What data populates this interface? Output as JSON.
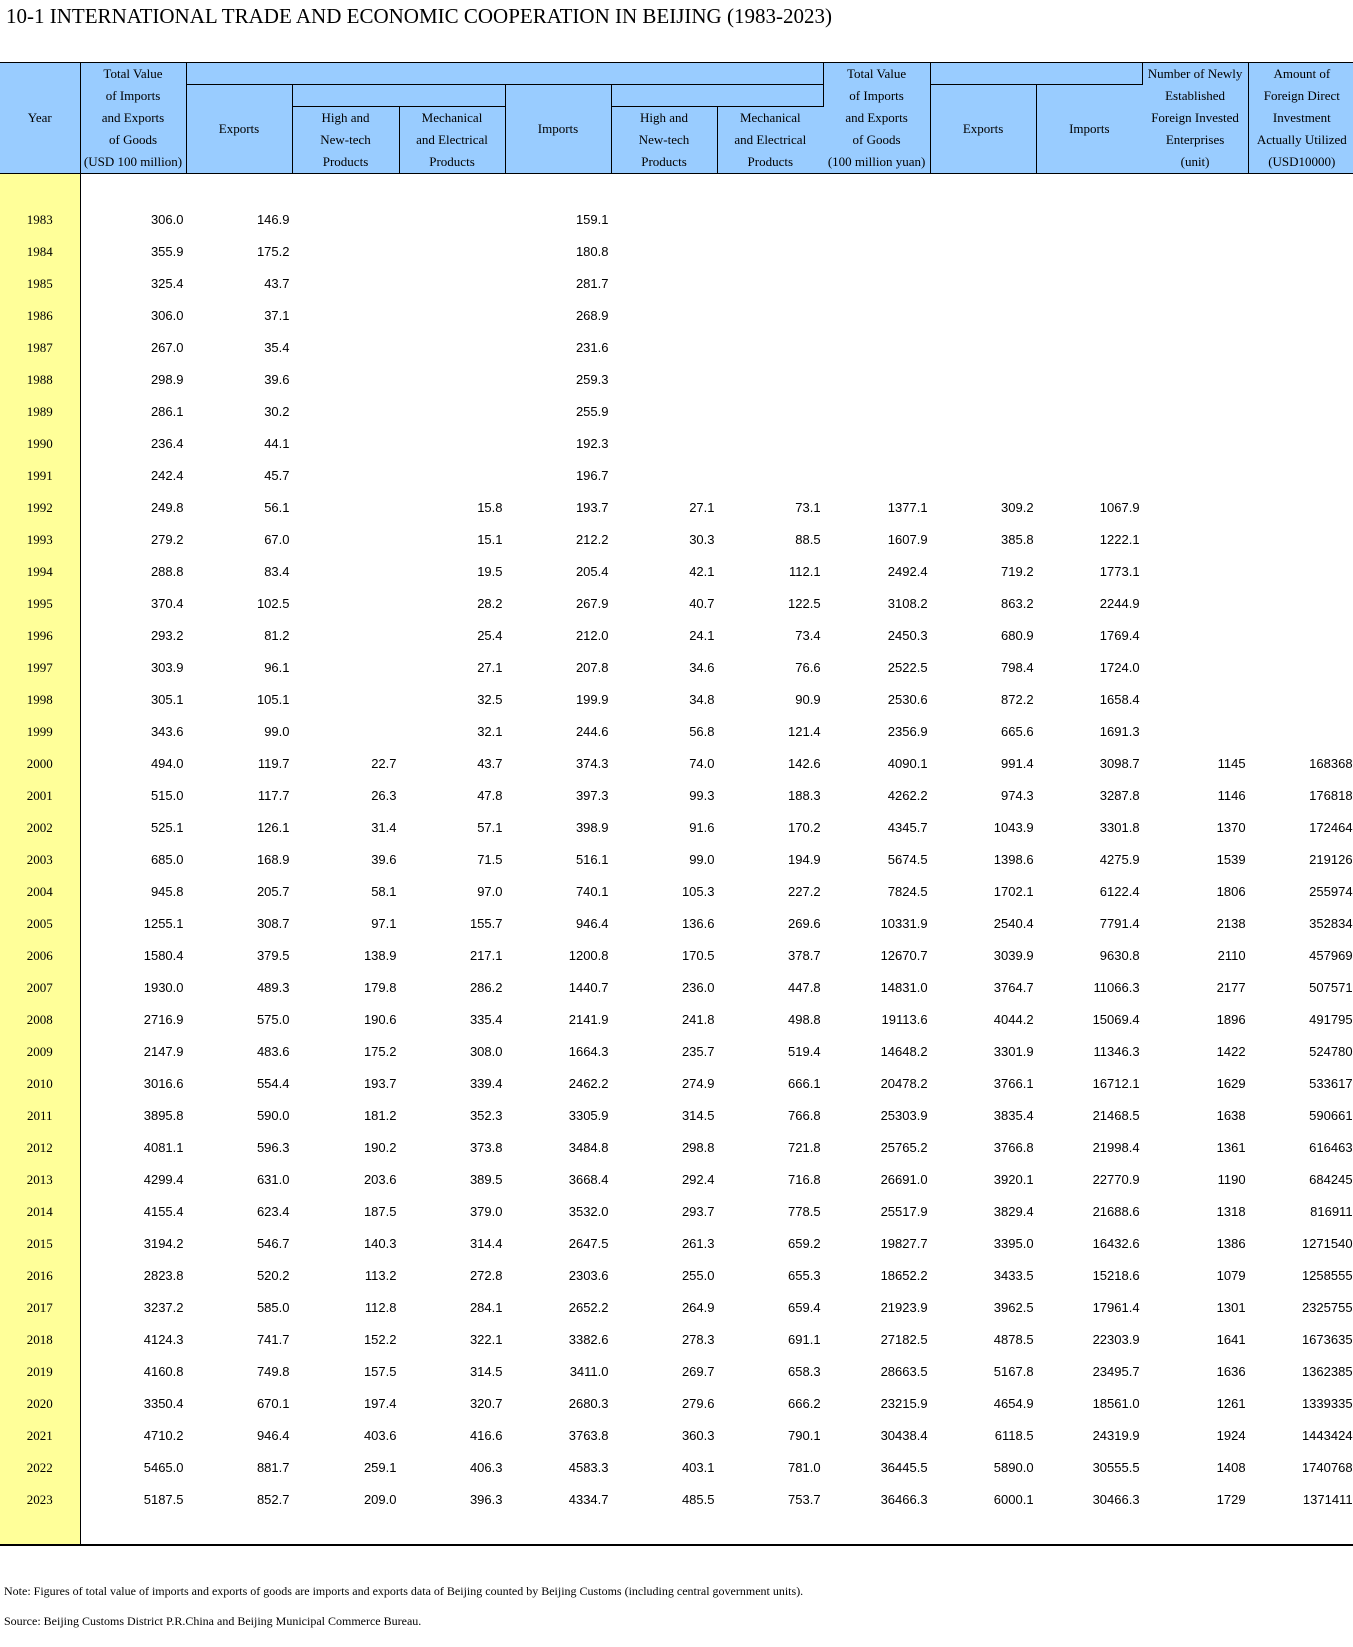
{
  "title": "10-1  INTERNATIONAL TRADE AND ECONOMIC COOPERATION IN BEIJING (1983-2023)",
  "headers": {
    "year": "Year",
    "total_usd": [
      "Total Value",
      "of Imports",
      "and Exports",
      "of Goods",
      "(USD 100 million)"
    ],
    "exports": "Exports",
    "high_tech": [
      "High and",
      "New-tech",
      "Products"
    ],
    "mech_elec": [
      "Mechanical",
      "and Electrical",
      "Products"
    ],
    "imports": "Imports",
    "total_yuan": [
      "Total Value",
      "of Imports",
      "and Exports",
      "of Goods",
      "(100 million yuan)"
    ],
    "exports_yuan": "Exports",
    "imports_yuan": "Imports",
    "enterprises": [
      "Number of Newly",
      "Established",
      "Foreign Invested",
      "Enterprises",
      "(unit)"
    ],
    "fdi": [
      "Amount of",
      "Foreign Direct",
      "Investment",
      "Actually Utilized",
      "(USD10000)"
    ]
  },
  "rows": [
    [
      "1983",
      "306.0",
      "146.9",
      "",
      "",
      "159.1",
      "",
      "",
      "",
      "",
      "",
      "",
      ""
    ],
    [
      "1984",
      "355.9",
      "175.2",
      "",
      "",
      "180.8",
      "",
      "",
      "",
      "",
      "",
      "",
      ""
    ],
    [
      "1985",
      "325.4",
      "43.7",
      "",
      "",
      "281.7",
      "",
      "",
      "",
      "",
      "",
      "",
      ""
    ],
    [
      "1986",
      "306.0",
      "37.1",
      "",
      "",
      "268.9",
      "",
      "",
      "",
      "",
      "",
      "",
      ""
    ],
    [
      "1987",
      "267.0",
      "35.4",
      "",
      "",
      "231.6",
      "",
      "",
      "",
      "",
      "",
      "",
      ""
    ],
    [
      "1988",
      "298.9",
      "39.6",
      "",
      "",
      "259.3",
      "",
      "",
      "",
      "",
      "",
      "",
      ""
    ],
    [
      "1989",
      "286.1",
      "30.2",
      "",
      "",
      "255.9",
      "",
      "",
      "",
      "",
      "",
      "",
      ""
    ],
    [
      "1990",
      "236.4",
      "44.1",
      "",
      "",
      "192.3",
      "",
      "",
      "",
      "",
      "",
      "",
      ""
    ],
    [
      "1991",
      "242.4",
      "45.7",
      "",
      "",
      "196.7",
      "",
      "",
      "",
      "",
      "",
      "",
      ""
    ],
    [
      "1992",
      "249.8",
      "56.1",
      "",
      "15.8",
      "193.7",
      "27.1",
      "73.1",
      "1377.1",
      "309.2",
      "1067.9",
      "",
      ""
    ],
    [
      "1993",
      "279.2",
      "67.0",
      "",
      "15.1",
      "212.2",
      "30.3",
      "88.5",
      "1607.9",
      "385.8",
      "1222.1",
      "",
      ""
    ],
    [
      "1994",
      "288.8",
      "83.4",
      "",
      "19.5",
      "205.4",
      "42.1",
      "112.1",
      "2492.4",
      "719.2",
      "1773.1",
      "",
      ""
    ],
    [
      "1995",
      "370.4",
      "102.5",
      "",
      "28.2",
      "267.9",
      "40.7",
      "122.5",
      "3108.2",
      "863.2",
      "2244.9",
      "",
      ""
    ],
    [
      "1996",
      "293.2",
      "81.2",
      "",
      "25.4",
      "212.0",
      "24.1",
      "73.4",
      "2450.3",
      "680.9",
      "1769.4",
      "",
      ""
    ],
    [
      "1997",
      "303.9",
      "96.1",
      "",
      "27.1",
      "207.8",
      "34.6",
      "76.6",
      "2522.5",
      "798.4",
      "1724.0",
      "",
      ""
    ],
    [
      "1998",
      "305.1",
      "105.1",
      "",
      "32.5",
      "199.9",
      "34.8",
      "90.9",
      "2530.6",
      "872.2",
      "1658.4",
      "",
      ""
    ],
    [
      "1999",
      "343.6",
      "99.0",
      "",
      "32.1",
      "244.6",
      "56.8",
      "121.4",
      "2356.9",
      "665.6",
      "1691.3",
      "",
      ""
    ],
    [
      "2000",
      "494.0",
      "119.7",
      "22.7",
      "43.7",
      "374.3",
      "74.0",
      "142.6",
      "4090.1",
      "991.4",
      "3098.7",
      "1145",
      "168368"
    ],
    [
      "2001",
      "515.0",
      "117.7",
      "26.3",
      "47.8",
      "397.3",
      "99.3",
      "188.3",
      "4262.2",
      "974.3",
      "3287.8",
      "1146",
      "176818"
    ],
    [
      "2002",
      "525.1",
      "126.1",
      "31.4",
      "57.1",
      "398.9",
      "91.6",
      "170.2",
      "4345.7",
      "1043.9",
      "3301.8",
      "1370",
      "172464"
    ],
    [
      "2003",
      "685.0",
      "168.9",
      "39.6",
      "71.5",
      "516.1",
      "99.0",
      "194.9",
      "5674.5",
      "1398.6",
      "4275.9",
      "1539",
      "219126"
    ],
    [
      "2004",
      "945.8",
      "205.7",
      "58.1",
      "97.0",
      "740.1",
      "105.3",
      "227.2",
      "7824.5",
      "1702.1",
      "6122.4",
      "1806",
      "255974"
    ],
    [
      "2005",
      "1255.1",
      "308.7",
      "97.1",
      "155.7",
      "946.4",
      "136.6",
      "269.6",
      "10331.9",
      "2540.4",
      "7791.4",
      "2138",
      "352834"
    ],
    [
      "2006",
      "1580.4",
      "379.5",
      "138.9",
      "217.1",
      "1200.8",
      "170.5",
      "378.7",
      "12670.7",
      "3039.9",
      "9630.8",
      "2110",
      "457969"
    ],
    [
      "2007",
      "1930.0",
      "489.3",
      "179.8",
      "286.2",
      "1440.7",
      "236.0",
      "447.8",
      "14831.0",
      "3764.7",
      "11066.3",
      "2177",
      "507571"
    ],
    [
      "2008",
      "2716.9",
      "575.0",
      "190.6",
      "335.4",
      "2141.9",
      "241.8",
      "498.8",
      "19113.6",
      "4044.2",
      "15069.4",
      "1896",
      "491795"
    ],
    [
      "2009",
      "2147.9",
      "483.6",
      "175.2",
      "308.0",
      "1664.3",
      "235.7",
      "519.4",
      "14648.2",
      "3301.9",
      "11346.3",
      "1422",
      "524780"
    ],
    [
      "2010",
      "3016.6",
      "554.4",
      "193.7",
      "339.4",
      "2462.2",
      "274.9",
      "666.1",
      "20478.2",
      "3766.1",
      "16712.1",
      "1629",
      "533617"
    ],
    [
      "2011",
      "3895.8",
      "590.0",
      "181.2",
      "352.3",
      "3305.9",
      "314.5",
      "766.8",
      "25303.9",
      "3835.4",
      "21468.5",
      "1638",
      "590661"
    ],
    [
      "2012",
      "4081.1",
      "596.3",
      "190.2",
      "373.8",
      "3484.8",
      "298.8",
      "721.8",
      "25765.2",
      "3766.8",
      "21998.4",
      "1361",
      "616463"
    ],
    [
      "2013",
      "4299.4",
      "631.0",
      "203.6",
      "389.5",
      "3668.4",
      "292.4",
      "716.8",
      "26691.0",
      "3920.1",
      "22770.9",
      "1190",
      "684245"
    ],
    [
      "2014",
      "4155.4",
      "623.4",
      "187.5",
      "379.0",
      "3532.0",
      "293.7",
      "778.5",
      "25517.9",
      "3829.4",
      "21688.6",
      "1318",
      "816911"
    ],
    [
      "2015",
      "3194.2",
      "546.7",
      "140.3",
      "314.4",
      "2647.5",
      "261.3",
      "659.2",
      "19827.7",
      "3395.0",
      "16432.6",
      "1386",
      "1271540"
    ],
    [
      "2016",
      "2823.8",
      "520.2",
      "113.2",
      "272.8",
      "2303.6",
      "255.0",
      "655.3",
      "18652.2",
      "3433.5",
      "15218.6",
      "1079",
      "1258555"
    ],
    [
      "2017",
      "3237.2",
      "585.0",
      "112.8",
      "284.1",
      "2652.2",
      "264.9",
      "659.4",
      "21923.9",
      "3962.5",
      "17961.4",
      "1301",
      "2325755"
    ],
    [
      "2018",
      "4124.3",
      "741.7",
      "152.2",
      "322.1",
      "3382.6",
      "278.3",
      "691.1",
      "27182.5",
      "4878.5",
      "22303.9",
      "1641",
      "1673635"
    ],
    [
      "2019",
      "4160.8",
      "749.8",
      "157.5",
      "314.5",
      "3411.0",
      "269.7",
      "658.3",
      "28663.5",
      "5167.8",
      "23495.7",
      "1636",
      "1362385"
    ],
    [
      "2020",
      "3350.4",
      "670.1",
      "197.4",
      "320.7",
      "2680.3",
      "279.6",
      "666.2",
      "23215.9",
      "4654.9",
      "18561.0",
      "1261",
      "1339335"
    ],
    [
      "2021",
      "4710.2",
      "946.4",
      "403.6",
      "416.6",
      "3763.8",
      "360.3",
      "790.1",
      "30438.4",
      "6118.5",
      "24319.9",
      "1924",
      "1443424"
    ],
    [
      "2022",
      "5465.0",
      "881.7",
      "259.1",
      "406.3",
      "4583.3",
      "403.1",
      "781.0",
      "36445.5",
      "5890.0",
      "30555.5",
      "1408",
      "1740768"
    ],
    [
      "2023",
      "5187.5",
      "852.7",
      "209.0",
      "396.3",
      "4334.7",
      "485.5",
      "753.7",
      "36466.3",
      "6000.1",
      "30466.3",
      "1729",
      "1371411"
    ]
  ],
  "note": "Note: Figures of total value of imports and exports of goods are imports and exports data of Beijing counted by Beijing Customs (including central government units).",
  "source": "Source: Beijing Customs District P.R.China and Beijing Municipal Commerce Bureau."
}
